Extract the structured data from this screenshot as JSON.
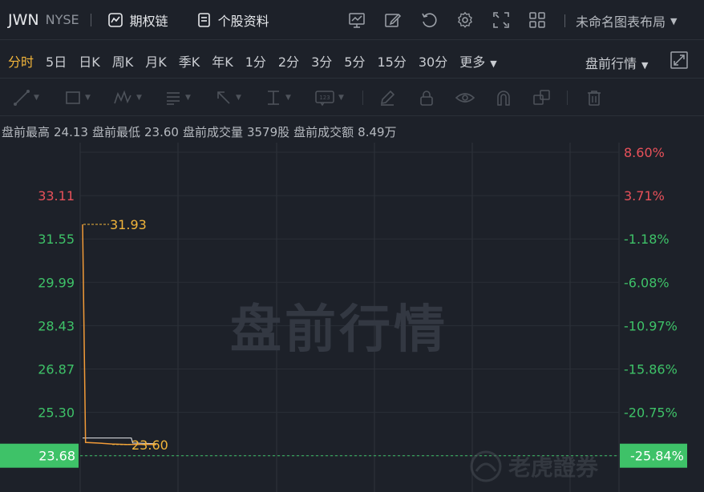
{
  "header": {
    "symbol": "JWN",
    "exchange": "NYSE",
    "options_chain_label": "期权链",
    "stock_profile_label": "个股资料",
    "layout_label": "未命名图表布局"
  },
  "periods": [
    "分时",
    "5日",
    "日K",
    "周K",
    "月K",
    "季K",
    "年K",
    "1分",
    "2分",
    "3分",
    "5分",
    "15分",
    "30分"
  ],
  "active_period": "分时",
  "more_label": "更多",
  "premarket_dropdown_label": "盘前行情",
  "premarket_stats": [
    {
      "label": "盘前最高",
      "value": "24.13"
    },
    {
      "label": "盘前最低",
      "value": "23.60"
    },
    {
      "label": "盘前成交量",
      "value": "3579股"
    },
    {
      "label": "盘前成交额",
      "value": "8.49万"
    }
  ],
  "watermark": "盘前行情",
  "logo_text": "老虎證券",
  "colors": {
    "up": "#e8515a",
    "down": "#3ec268",
    "accent": "#f2b53a",
    "price_line": "#f29b38"
  },
  "chart_data": {
    "type": "line",
    "y_labels": [
      "33.11",
      "31.55",
      "29.99",
      "28.43",
      "26.87",
      "25.30",
      "23.68"
    ],
    "pct_labels": [
      "8.60%",
      "3.71%",
      "-1.18%",
      "-6.08%",
      "-10.97%",
      "-15.86%",
      "-20.75%",
      "-25.84%"
    ],
    "ylim": [
      23.2,
      34.66
    ],
    "high_annotation": "31.93",
    "low_annotation": "23.60",
    "current_price": "23.68",
    "current_pct": "-25.84%",
    "price_series": [
      {
        "t": 0,
        "price": 31.93
      },
      {
        "t": 0.2,
        "price": 23.68
      },
      {
        "t": 1,
        "price": 23.66
      },
      {
        "t": 2,
        "price": 23.62
      },
      {
        "t": 3,
        "price": 23.6
      },
      {
        "t": 4,
        "price": 23.61
      },
      {
        "t": 5,
        "price": 23.6
      }
    ],
    "avg_series": [
      {
        "t": 0,
        "price": 23.85
      },
      {
        "t": 3.3,
        "price": 23.85
      },
      {
        "t": 3.4,
        "price": 23.66
      },
      {
        "t": 5,
        "price": 23.63
      }
    ],
    "t_max": 5
  }
}
